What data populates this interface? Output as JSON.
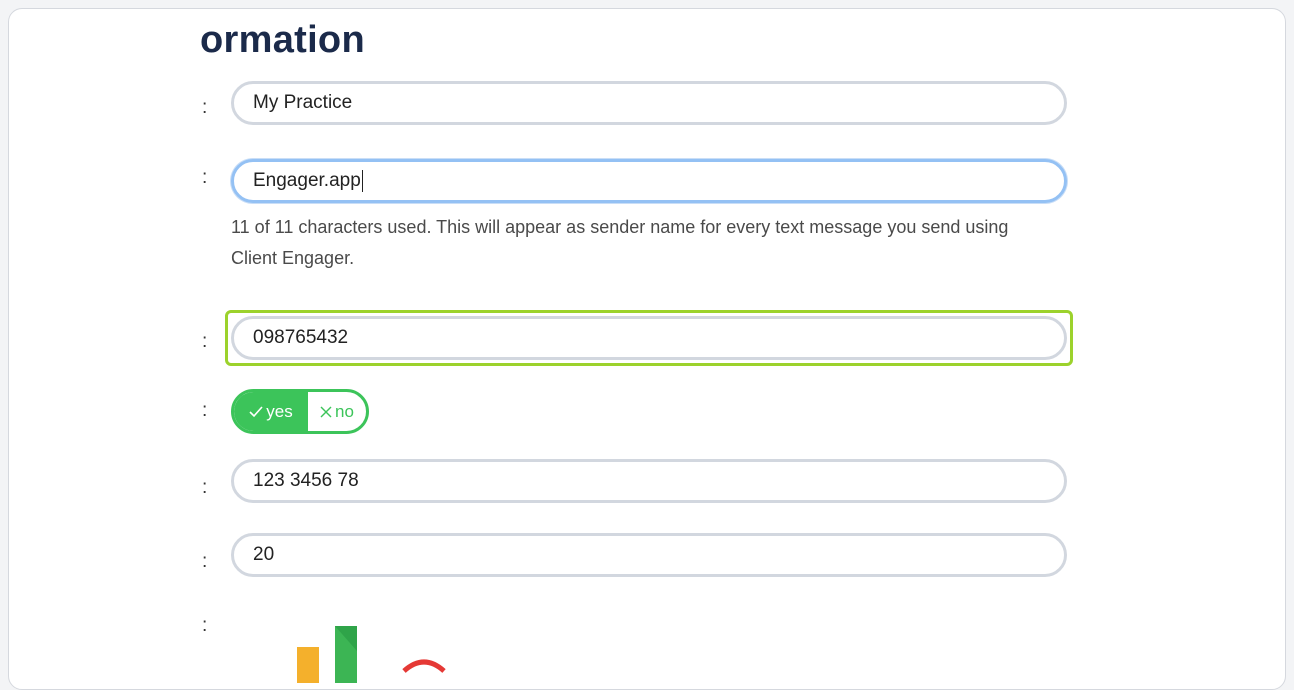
{
  "heading": "ormation",
  "colon": ":",
  "fields": {
    "name": {
      "value": "My Practice"
    },
    "sender": {
      "value": "Engager.app"
    },
    "sender_help": "11 of 11 characters used. This will appear as sender name for every text message you send using Client Engager.",
    "phone": {
      "value": "098765432"
    },
    "toggle": {
      "yes_label": "yes",
      "no_label": "no",
      "selected": "yes"
    },
    "number": {
      "value": "123 3456 78"
    },
    "amount": {
      "value": "20"
    }
  },
  "colors": {
    "toggle_green": "#3cc45a",
    "highlight": "#9cd22c",
    "focus": "#94c1f4",
    "heading": "#1b2a4a"
  },
  "icons": [
    "check-icon",
    "x-icon",
    "logo-bars-icon"
  ]
}
